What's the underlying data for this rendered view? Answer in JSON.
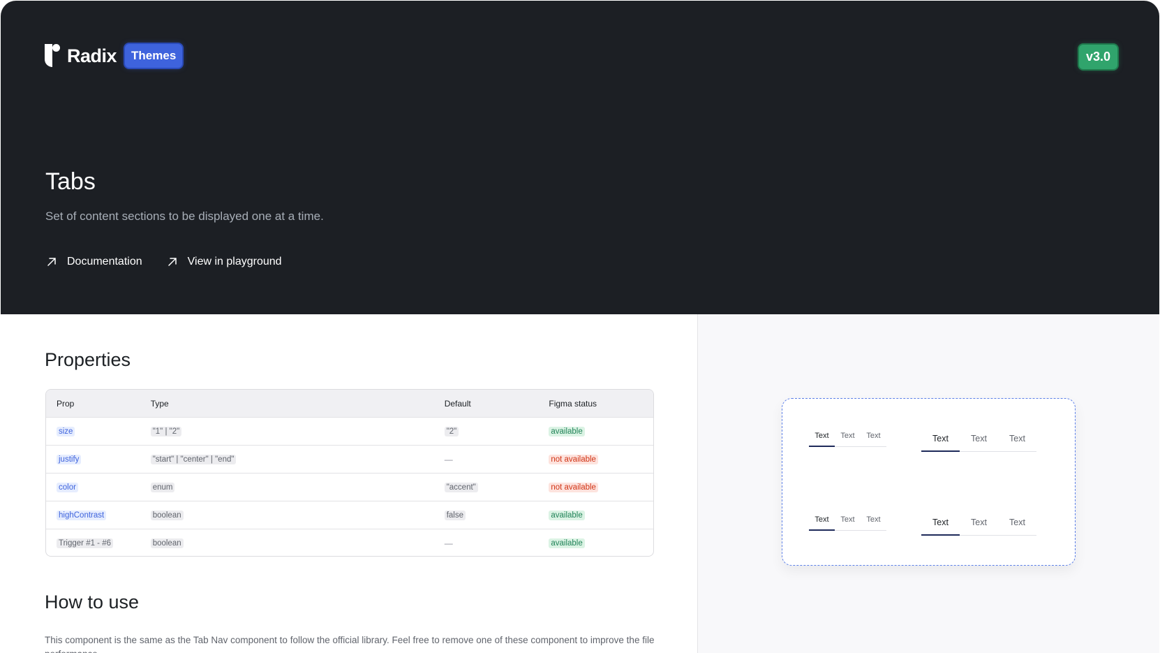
{
  "brand": {
    "logo_text": "Radix",
    "product_badge": "Themes",
    "version_badge": "v3.0",
    "colors": {
      "hero_bg": "#1c1f24",
      "themes_badge": "#3e63dd",
      "version_badge": "#30a46c"
    }
  },
  "hero": {
    "title": "Tabs",
    "subtitle": "Set of content sections to be displayed one at a time.",
    "links": [
      {
        "label": "Documentation",
        "icon": "arrow-up-right-icon"
      },
      {
        "label": "View in playground",
        "icon": "arrow-up-right-icon"
      }
    ]
  },
  "properties": {
    "title": "Properties",
    "columns": [
      "Prop",
      "Type",
      "Default",
      "Figma status"
    ],
    "rows": [
      {
        "prop": "size",
        "type": "\"1\" | \"2\"",
        "default": "\"2\"",
        "status": "available"
      },
      {
        "prop": "justify",
        "type": "\"start\" | \"center\" | \"end\"",
        "default": "—",
        "status": "not available"
      },
      {
        "prop": "color",
        "type": "enum",
        "default": "\"accent\"",
        "status": "not available"
      },
      {
        "prop": "highContrast",
        "type": "boolean",
        "default": "false",
        "status": "available"
      },
      {
        "prop": "Trigger #1 - #6",
        "type": "boolean",
        "default": "—",
        "status": "available"
      }
    ]
  },
  "how_to_use": {
    "title": "How to use",
    "text": "This component is the same as the Tab Nav component to follow the official library. Feel free to remove one of these component to improve the file performance."
  },
  "preview": {
    "tabs": [
      "Text",
      "Text",
      "Text"
    ]
  }
}
